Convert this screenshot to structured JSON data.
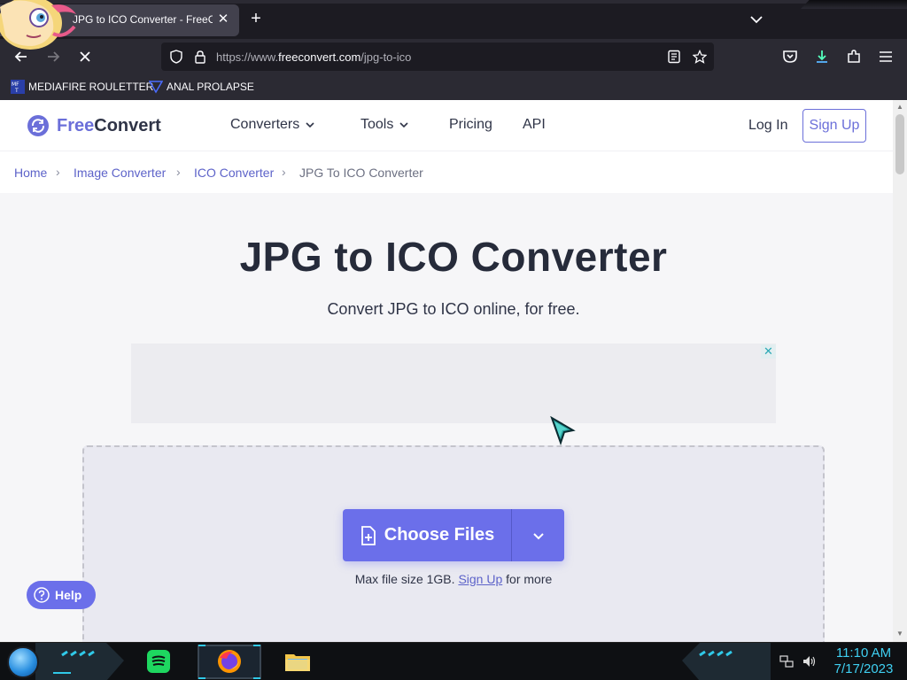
{
  "browser": {
    "tab_title": "JPG to ICO Converter - FreeConvert",
    "tab_close": "✕",
    "new_tab": "+",
    "url_prefix": "https://www.",
    "url_domain": "freeconvert.com",
    "url_path": "/jpg-to-ico",
    "bookmarks": [
      {
        "label": "MEDIAFIRE ROULETTER",
        "icon": "mft-icon"
      },
      {
        "label": "ANAL PROLAPSE",
        "icon": "bookmark-icon"
      }
    ]
  },
  "site": {
    "logo_free": "Free",
    "logo_convert": "Convert",
    "nav": [
      {
        "label": "Converters",
        "dropdown": true
      },
      {
        "label": "Tools",
        "dropdown": true
      },
      {
        "label": "Pricing",
        "dropdown": false
      },
      {
        "label": "API",
        "dropdown": false
      }
    ],
    "login": "Log In",
    "signup": "Sign Up"
  },
  "breadcrumb": {
    "items": [
      "Home",
      "Image Converter",
      "ICO Converter"
    ],
    "current": "JPG To ICO Converter",
    "separator": "›"
  },
  "main": {
    "title": "JPG to ICO Converter",
    "subtitle": "Convert JPG to ICO online, for free.",
    "ad_close": "✕",
    "choose_files": "Choose Files",
    "max_size_prefix": "Max file size 1GB.",
    "max_size_link": "Sign Up",
    "max_size_suffix": "for more",
    "help": "Help"
  },
  "taskbar": {
    "time": "11:10 AM",
    "date": "7/17/2023",
    "apps": [
      "spotify-icon",
      "firefox-icon",
      "file-explorer-icon"
    ]
  },
  "colors": {
    "accent": "#6b6fea",
    "link": "#5d63c9",
    "clock": "#3fd0f2"
  }
}
